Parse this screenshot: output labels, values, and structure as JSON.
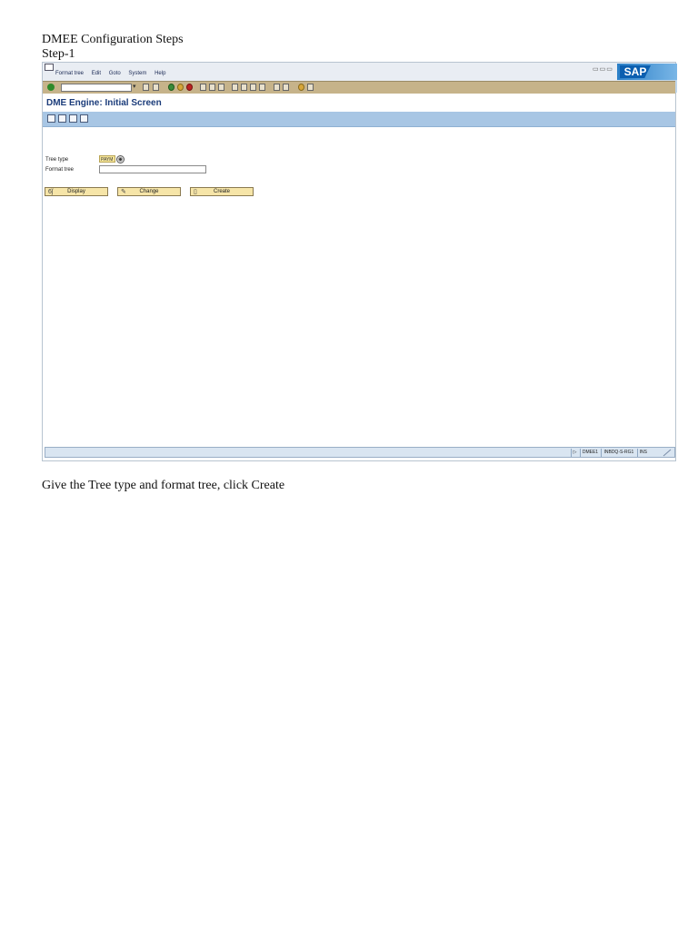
{
  "document": {
    "title": "DMEE Configuration Steps",
    "step": "Step-1",
    "caption": "Give the Tree type and format tree, click Create"
  },
  "sap": {
    "menu": [
      "Format tree",
      "Edit",
      "Goto",
      "System",
      "Help"
    ],
    "window_controls": "▭▭▭",
    "logo": "SAP",
    "command_field": {
      "value": ""
    },
    "screen_title": "DME Engine: Initial Screen",
    "form": {
      "tree_type_label": "Tree type",
      "tree_type_value": "PAYM",
      "format_tree_label": "Format tree",
      "format_tree_value": ""
    },
    "buttons": {
      "display": "Display",
      "change": "Change",
      "create": "Create"
    },
    "status": {
      "transaction": "DMEE1",
      "server": "INBDQ-S-RG1",
      "mode": "INS"
    }
  },
  "colors": {
    "toolbar": "#c6b38a",
    "app_toolbar": "#a8c6e4",
    "button": "#f6e5a8",
    "title": "#1b3c7a"
  }
}
